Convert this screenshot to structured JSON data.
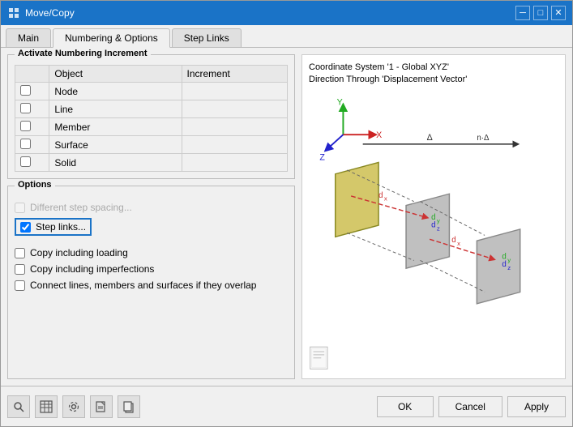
{
  "window": {
    "title": "Move/Copy",
    "icon": "move-copy-icon"
  },
  "tabs": [
    {
      "id": "main",
      "label": "Main",
      "active": false
    },
    {
      "id": "numbering-options",
      "label": "Numbering & Options",
      "active": true
    },
    {
      "id": "step-links",
      "label": "Step Links",
      "active": false
    }
  ],
  "numbering_group": {
    "label": "Activate Numbering Increment",
    "columns": [
      "Object",
      "Increment"
    ],
    "rows": [
      {
        "checked": false,
        "object": "Node",
        "increment": ""
      },
      {
        "checked": false,
        "object": "Line",
        "increment": ""
      },
      {
        "checked": false,
        "object": "Member",
        "increment": ""
      },
      {
        "checked": false,
        "object": "Surface",
        "increment": ""
      },
      {
        "checked": false,
        "object": "Solid",
        "increment": ""
      }
    ]
  },
  "options_group": {
    "label": "Options",
    "items": [
      {
        "id": "different-step",
        "label": "Different step spacing...",
        "checked": false,
        "disabled": true
      },
      {
        "id": "step-links",
        "label": "Step links...",
        "checked": true,
        "highlighted": true
      }
    ],
    "checkboxes": [
      {
        "id": "copy-loading",
        "label": "Copy including loading",
        "checked": false
      },
      {
        "id": "copy-imperfections",
        "label": "Copy including imperfections",
        "checked": false
      },
      {
        "id": "connect-lines",
        "label": "Connect lines, members and surfaces if they overlap",
        "checked": false
      }
    ]
  },
  "coord_system": {
    "title_line1": "Coordinate System '1 - Global XYZ'",
    "title_line2": "Direction Through 'Displacement Vector'"
  },
  "bottom_icons": [
    "search-icon",
    "table-icon",
    "settings-icon",
    "export-icon",
    "copy-icon"
  ],
  "buttons": {
    "ok": "OK",
    "cancel": "Cancel",
    "apply": "Apply"
  }
}
